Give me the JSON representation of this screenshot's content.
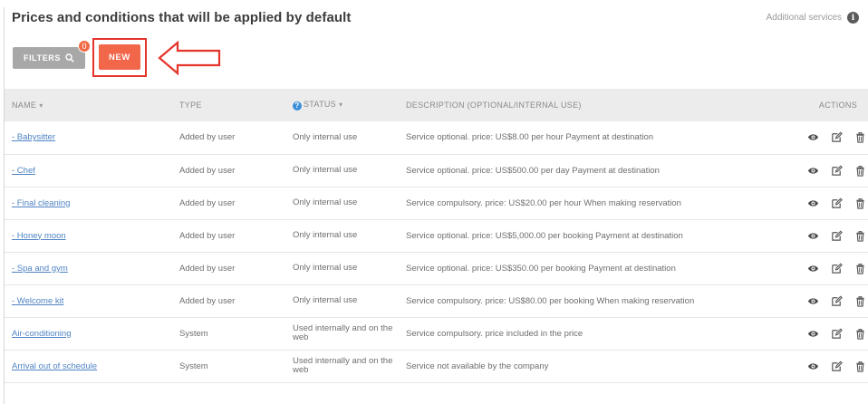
{
  "header": {
    "title": "Prices and conditions that will be applied by default",
    "additional_services": "Additional services",
    "info_icon": "info-icon"
  },
  "toolbar": {
    "filters_label": "FILTERS",
    "filters_badge": "0",
    "new_label": "NEW",
    "highlight_color": "#e5342a",
    "new_color": "#f2664a"
  },
  "table": {
    "columns": {
      "name": "NAME",
      "type": "TYPE",
      "status": "STATUS",
      "description": "DESCRIPTION (OPTIONAL/INTERNAL USE)",
      "actions": "ACTIONS"
    },
    "rows": [
      {
        "name": "- Babysitter",
        "type": "Added by user",
        "status": "Only internal use",
        "description": "Service optional. price: US$8.00 per hour Payment at destination"
      },
      {
        "name": "- Chef",
        "type": "Added by user",
        "status": "Only internal use",
        "description": "Service optional. price: US$500.00 per day Payment at destination"
      },
      {
        "name": "- Final cleaning",
        "type": "Added by user",
        "status": "Only internal use",
        "description": "Service compulsory. price: US$20.00 per hour When making reservation"
      },
      {
        "name": "- Honey moon",
        "type": "Added by user",
        "status": "Only internal use",
        "description": "Service optional. price: US$5,000.00 per booking Payment at destination"
      },
      {
        "name": "- Spa and gym",
        "type": "Added by user",
        "status": "Only internal use",
        "description": "Service optional. price: US$350.00 per booking Payment at destination"
      },
      {
        "name": "- Welcome kit",
        "type": "Added by user",
        "status": "Only internal use",
        "description": "Service compulsory. price: US$80.00 per booking When making reservation"
      },
      {
        "name": "Air-conditioning",
        "type": "System",
        "status": "Used internally and on the web",
        "description": "Service compulsory. price included in the price"
      },
      {
        "name": "Arrival out of schedule",
        "type": "System",
        "status": "Used internally and on the web",
        "description": "Service not available by the company"
      }
    ]
  }
}
